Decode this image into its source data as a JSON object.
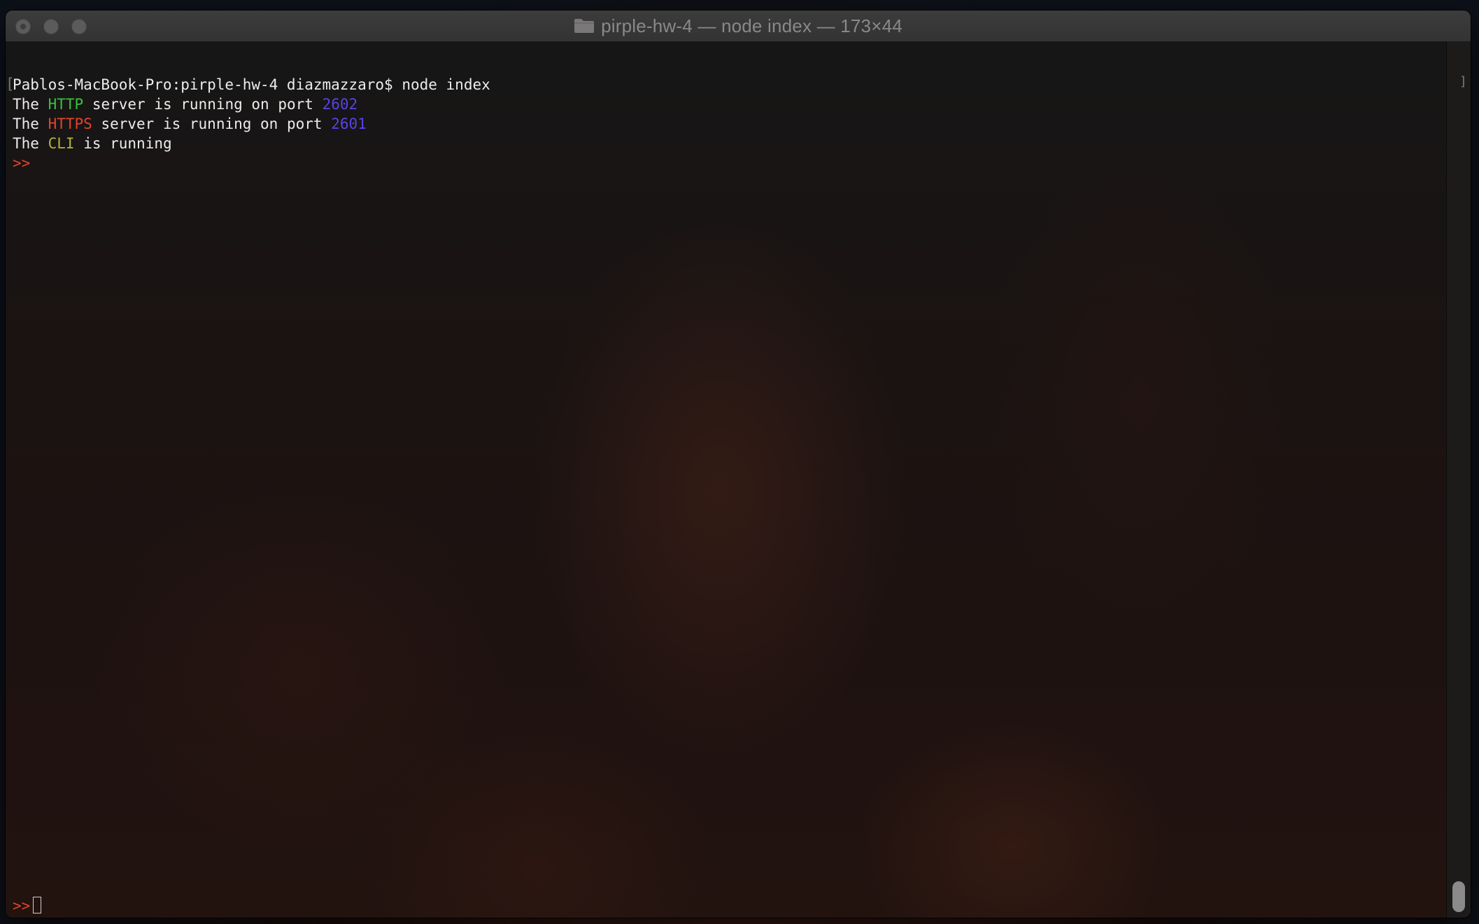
{
  "window": {
    "title": "pirple-hw-4 — node index — 173×44"
  },
  "terminal": {
    "prompt_line": {
      "prompt": "Pablos-MacBook-Pro:pirple-hw-4 diazmazzaro$",
      "command": "node index"
    },
    "http_line": {
      "prefix": "The",
      "keyword": "HTTP",
      "middle": "server is running on port",
      "port": "2602"
    },
    "https_line": {
      "prefix": "The",
      "keyword": "HTTPS",
      "middle": "server is running on port",
      "port": "2601"
    },
    "cli_line": {
      "prefix": "The",
      "keyword": "CLI",
      "suffix": "is running"
    },
    "repl_prompt": ">>"
  },
  "colors": {
    "http": "#37c33a",
    "https": "#e2432e",
    "port": "#5743e6",
    "cli": "#b8b23a",
    "repl_prompt": "#e2432e"
  },
  "icons": {
    "title_icon": "folder-icon"
  }
}
